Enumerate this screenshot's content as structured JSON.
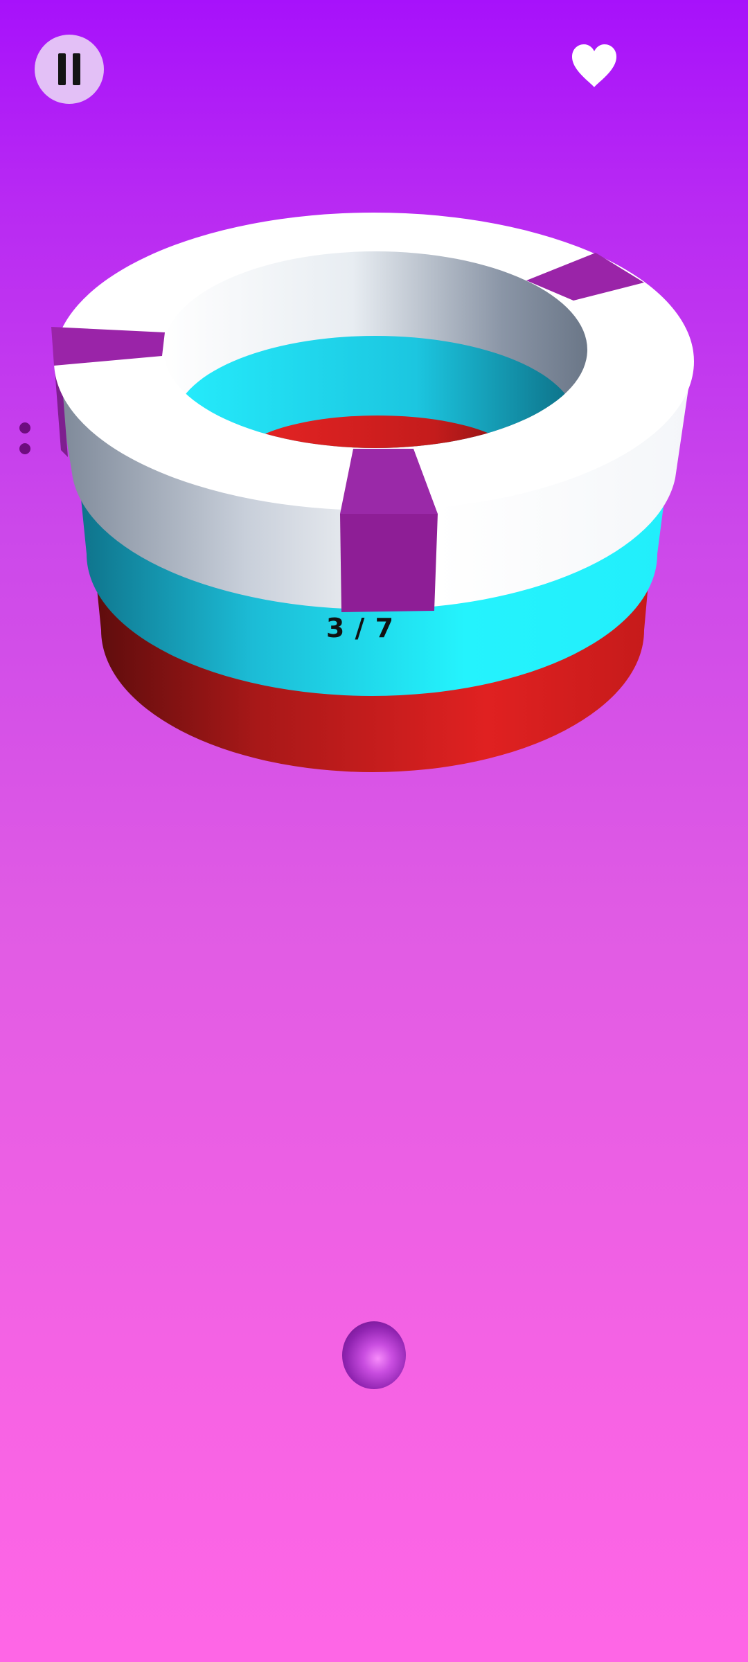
{
  "hud": {
    "pause_icon": "pause-icon",
    "lives_icon": "heart-icon"
  },
  "level_progress": {
    "text": "3 / 7",
    "current": 3,
    "total": 7
  },
  "tower": {
    "ring_colors_top_to_bottom": [
      "#ffffff",
      "#22eefb",
      "#e02121"
    ],
    "platform_color": "#ffffff",
    "obstacle_color": "#9024a3",
    "inner_colors": [
      "#22eefb",
      "#e02121"
    ]
  },
  "player": {
    "icon": "ball-icon",
    "color": "#c94de0"
  },
  "colors": {
    "background_top": "#a711fb",
    "background_bottom": "#fe66e6",
    "pause_button_bg": "#e3c0f6",
    "dots": "#6e0d7f"
  }
}
